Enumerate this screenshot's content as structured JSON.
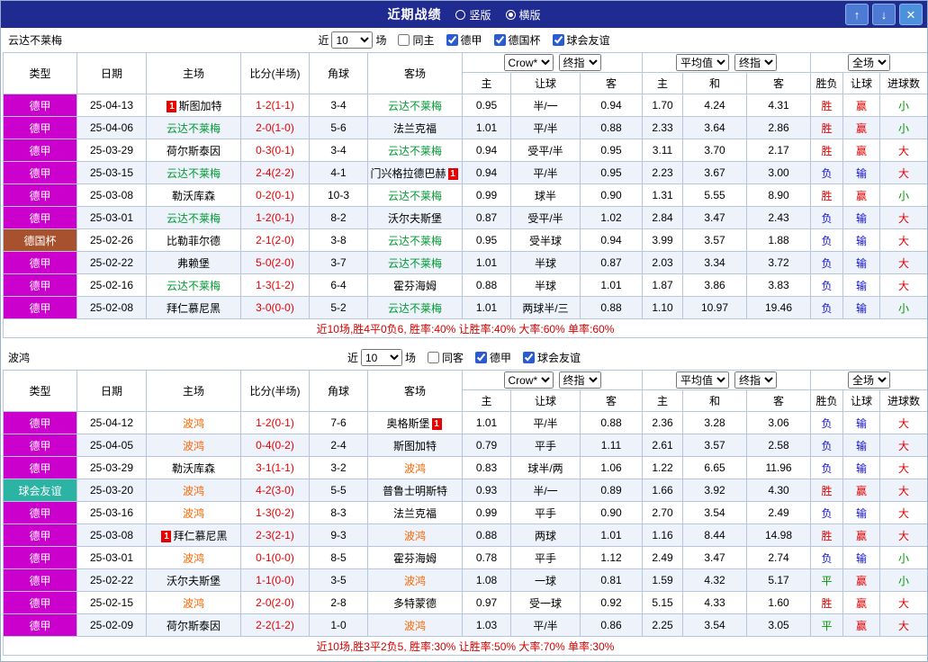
{
  "header": {
    "title": "近期战绩",
    "view_options": [
      {
        "label": "竖版",
        "selected": false
      },
      {
        "label": "横版",
        "selected": true
      }
    ],
    "buttons": {
      "up": "↑",
      "down": "↓",
      "close": "✕"
    }
  },
  "colors": {
    "titlebar_bg": "#1f2b90",
    "button_bg": "#4d7ad2",
    "close_button_bg": "#4d90dc",
    "border": "#b7c5dd",
    "stripe": "#eef3fb",
    "score": "#e60000",
    "summary": "#d40000",
    "type_colors": {
      "德甲": "#cc00cc",
      "德国杯": "#a8512e",
      "球会友谊": "#2bb3a3"
    },
    "result": {
      "red": "#e60000",
      "blue": "#1313cf",
      "green": "#009900"
    }
  },
  "sections": [
    {
      "team": "云达不莱梅",
      "team_color": "#009933",
      "filter": {
        "prefix": "近",
        "count": "10",
        "suffix": "场",
        "checkboxes": [
          {
            "label": "同主",
            "checked": false
          },
          {
            "label": "德甲",
            "checked": true
          },
          {
            "label": "德国杯",
            "checked": true
          },
          {
            "label": "球会友谊",
            "checked": true
          }
        ]
      },
      "selects": {
        "company": "Crow*",
        "company_stage": "终指",
        "euro": "平均值",
        "euro_stage": "终指",
        "scope": "全场"
      },
      "columns": [
        "类型",
        "日期",
        "主场",
        "比分(半场)",
        "角球",
        "客场",
        "主",
        "让球",
        "客",
        "主",
        "和",
        "客",
        "胜负",
        "让球",
        "进球数"
      ],
      "rows": [
        {
          "tp": "德甲",
          "dt": "25-04-13",
          "hm": "斯图加特",
          "hmT": false,
          "hmC": "before",
          "sc": "1-2(1-1)",
          "cn": "3-4",
          "aw": "云达不莱梅",
          "awT": true,
          "awC": "",
          "od": [
            "0.95",
            "半/一",
            "0.94"
          ],
          "eu": [
            "1.70",
            "4.24",
            "4.31"
          ],
          "rs": [
            [
              "胜",
              "red"
            ],
            [
              "赢",
              "red"
            ],
            [
              "小",
              "green"
            ]
          ]
        },
        {
          "tp": "德甲",
          "dt": "25-04-06",
          "hm": "云达不莱梅",
          "hmT": true,
          "hmC": "",
          "sc": "2-0(1-0)",
          "cn": "5-6",
          "aw": "法兰克福",
          "awT": false,
          "awC": "",
          "od": [
            "1.01",
            "平/半",
            "0.88"
          ],
          "eu": [
            "2.33",
            "3.64",
            "2.86"
          ],
          "rs": [
            [
              "胜",
              "red"
            ],
            [
              "赢",
              "red"
            ],
            [
              "小",
              "green"
            ]
          ]
        },
        {
          "tp": "德甲",
          "dt": "25-03-29",
          "hm": "荷尔斯泰因",
          "hmT": false,
          "hmC": "",
          "sc": "0-3(0-1)",
          "cn": "3-4",
          "aw": "云达不莱梅",
          "awT": true,
          "awC": "",
          "od": [
            "0.94",
            "受平/半",
            "0.95"
          ],
          "eu": [
            "3.11",
            "3.70",
            "2.17"
          ],
          "rs": [
            [
              "胜",
              "red"
            ],
            [
              "赢",
              "red"
            ],
            [
              "大",
              "red"
            ]
          ]
        },
        {
          "tp": "德甲",
          "dt": "25-03-15",
          "hm": "云达不莱梅",
          "hmT": true,
          "hmC": "",
          "sc": "2-4(2-2)",
          "cn": "4-1",
          "aw": "门兴格拉德巴赫",
          "awT": false,
          "awC": "after",
          "od": [
            "0.94",
            "平/半",
            "0.95"
          ],
          "eu": [
            "2.23",
            "3.67",
            "3.00"
          ],
          "rs": [
            [
              "负",
              "blue"
            ],
            [
              "输",
              "blue"
            ],
            [
              "大",
              "red"
            ]
          ]
        },
        {
          "tp": "德甲",
          "dt": "25-03-08",
          "hm": "勒沃库森",
          "hmT": false,
          "hmC": "",
          "sc": "0-2(0-1)",
          "cn": "10-3",
          "aw": "云达不莱梅",
          "awT": true,
          "awC": "",
          "od": [
            "0.99",
            "球半",
            "0.90"
          ],
          "eu": [
            "1.31",
            "5.55",
            "8.90"
          ],
          "rs": [
            [
              "胜",
              "red"
            ],
            [
              "赢",
              "red"
            ],
            [
              "小",
              "green"
            ]
          ]
        },
        {
          "tp": "德甲",
          "dt": "25-03-01",
          "hm": "云达不莱梅",
          "hmT": true,
          "hmC": "",
          "sc": "1-2(0-1)",
          "cn": "8-2",
          "aw": "沃尔夫斯堡",
          "awT": false,
          "awC": "",
          "od": [
            "0.87",
            "受平/半",
            "1.02"
          ],
          "eu": [
            "2.84",
            "3.47",
            "2.43"
          ],
          "rs": [
            [
              "负",
              "blue"
            ],
            [
              "输",
              "blue"
            ],
            [
              "大",
              "red"
            ]
          ]
        },
        {
          "tp": "德国杯",
          "dt": "25-02-26",
          "hm": "比勒菲尔德",
          "hmT": false,
          "hmC": "",
          "sc": "2-1(2-0)",
          "cn": "3-8",
          "aw": "云达不莱梅",
          "awT": true,
          "awC": "",
          "od": [
            "0.95",
            "受半球",
            "0.94"
          ],
          "eu": [
            "3.99",
            "3.57",
            "1.88"
          ],
          "rs": [
            [
              "负",
              "blue"
            ],
            [
              "输",
              "blue"
            ],
            [
              "大",
              "red"
            ]
          ]
        },
        {
          "tp": "德甲",
          "dt": "25-02-22",
          "hm": "弗赖堡",
          "hmT": false,
          "hmC": "",
          "sc": "5-0(2-0)",
          "cn": "3-7",
          "aw": "云达不莱梅",
          "awT": true,
          "awC": "",
          "od": [
            "1.01",
            "半球",
            "0.87"
          ],
          "eu": [
            "2.03",
            "3.34",
            "3.72"
          ],
          "rs": [
            [
              "负",
              "blue"
            ],
            [
              "输",
              "blue"
            ],
            [
              "大",
              "red"
            ]
          ]
        },
        {
          "tp": "德甲",
          "dt": "25-02-16",
          "hm": "云达不莱梅",
          "hmT": true,
          "hmC": "",
          "sc": "1-3(1-2)",
          "cn": "6-4",
          "aw": "霍芬海姆",
          "awT": false,
          "awC": "",
          "od": [
            "0.88",
            "半球",
            "1.01"
          ],
          "eu": [
            "1.87",
            "3.86",
            "3.83"
          ],
          "rs": [
            [
              "负",
              "blue"
            ],
            [
              "输",
              "blue"
            ],
            [
              "大",
              "red"
            ]
          ]
        },
        {
          "tp": "德甲",
          "dt": "25-02-08",
          "hm": "拜仁慕尼黑",
          "hmT": false,
          "hmC": "",
          "sc": "3-0(0-0)",
          "cn": "5-2",
          "aw": "云达不莱梅",
          "awT": true,
          "awC": "",
          "od": [
            "1.01",
            "两球半/三",
            "0.88"
          ],
          "eu": [
            "1.10",
            "10.97",
            "19.46"
          ],
          "rs": [
            [
              "负",
              "blue"
            ],
            [
              "输",
              "blue"
            ],
            [
              "小",
              "green"
            ]
          ]
        }
      ],
      "summary": "近10场,胜4平0负6, 胜率:40% 让胜率:40% 大率:60% 单率:60%"
    },
    {
      "team": "波鸿",
      "team_color": "#ff6600",
      "filter": {
        "prefix": "近",
        "count": "10",
        "suffix": "场",
        "checkboxes": [
          {
            "label": "同客",
            "checked": false
          },
          {
            "label": "德甲",
            "checked": true
          },
          {
            "label": "球会友谊",
            "checked": true
          }
        ]
      },
      "selects": {
        "company": "Crow*",
        "company_stage": "终指",
        "euro": "平均值",
        "euro_stage": "终指",
        "scope": "全场"
      },
      "columns": [
        "类型",
        "日期",
        "主场",
        "比分(半场)",
        "角球",
        "客场",
        "主",
        "让球",
        "客",
        "主",
        "和",
        "客",
        "胜负",
        "让球",
        "进球数"
      ],
      "rows": [
        {
          "tp": "德甲",
          "dt": "25-04-12",
          "hm": "波鸿",
          "hmT": true,
          "hmC": "",
          "sc": "1-2(0-1)",
          "cn": "7-6",
          "aw": "奥格斯堡",
          "awT": false,
          "awC": "after",
          "od": [
            "1.01",
            "平/半",
            "0.88"
          ],
          "eu": [
            "2.36",
            "3.28",
            "3.06"
          ],
          "rs": [
            [
              "负",
              "blue"
            ],
            [
              "输",
              "blue"
            ],
            [
              "大",
              "red"
            ]
          ]
        },
        {
          "tp": "德甲",
          "dt": "25-04-05",
          "hm": "波鸿",
          "hmT": true,
          "hmC": "",
          "sc": "0-4(0-2)",
          "cn": "2-4",
          "aw": "斯图加特",
          "awT": false,
          "awC": "",
          "od": [
            "0.79",
            "平手",
            "1.11"
          ],
          "eu": [
            "2.61",
            "3.57",
            "2.58"
          ],
          "rs": [
            [
              "负",
              "blue"
            ],
            [
              "输",
              "blue"
            ],
            [
              "大",
              "red"
            ]
          ]
        },
        {
          "tp": "德甲",
          "dt": "25-03-29",
          "hm": "勒沃库森",
          "hmT": false,
          "hmC": "",
          "sc": "3-1(1-1)",
          "cn": "3-2",
          "aw": "波鸿",
          "awT": true,
          "awC": "",
          "od": [
            "0.83",
            "球半/两",
            "1.06"
          ],
          "eu": [
            "1.22",
            "6.65",
            "11.96"
          ],
          "rs": [
            [
              "负",
              "blue"
            ],
            [
              "输",
              "blue"
            ],
            [
              "大",
              "red"
            ]
          ]
        },
        {
          "tp": "球会友谊",
          "dt": "25-03-20",
          "hm": "波鸿",
          "hmT": true,
          "hmC": "",
          "sc": "4-2(3-0)",
          "cn": "5-5",
          "aw": "普鲁士明斯特",
          "awT": false,
          "awC": "",
          "od": [
            "0.93",
            "半/一",
            "0.89"
          ],
          "eu": [
            "1.66",
            "3.92",
            "4.30"
          ],
          "rs": [
            [
              "胜",
              "red"
            ],
            [
              "赢",
              "red"
            ],
            [
              "大",
              "red"
            ]
          ]
        },
        {
          "tp": "德甲",
          "dt": "25-03-16",
          "hm": "波鸿",
          "hmT": true,
          "hmC": "",
          "sc": "1-3(0-2)",
          "cn": "8-3",
          "aw": "法兰克福",
          "awT": false,
          "awC": "",
          "od": [
            "0.99",
            "平手",
            "0.90"
          ],
          "eu": [
            "2.70",
            "3.54",
            "2.49"
          ],
          "rs": [
            [
              "负",
              "blue"
            ],
            [
              "输",
              "blue"
            ],
            [
              "大",
              "red"
            ]
          ]
        },
        {
          "tp": "德甲",
          "dt": "25-03-08",
          "hm": "拜仁慕尼黑",
          "hmT": false,
          "hmC": "before",
          "sc": "2-3(2-1)",
          "cn": "9-3",
          "aw": "波鸿",
          "awT": true,
          "awC": "",
          "od": [
            "0.88",
            "两球",
            "1.01"
          ],
          "eu": [
            "1.16",
            "8.44",
            "14.98"
          ],
          "rs": [
            [
              "胜",
              "red"
            ],
            [
              "赢",
              "red"
            ],
            [
              "大",
              "red"
            ]
          ]
        },
        {
          "tp": "德甲",
          "dt": "25-03-01",
          "hm": "波鸿",
          "hmT": true,
          "hmC": "",
          "sc": "0-1(0-0)",
          "cn": "8-5",
          "aw": "霍芬海姆",
          "awT": false,
          "awC": "",
          "od": [
            "0.78",
            "平手",
            "1.12"
          ],
          "eu": [
            "2.49",
            "3.47",
            "2.74"
          ],
          "rs": [
            [
              "负",
              "blue"
            ],
            [
              "输",
              "blue"
            ],
            [
              "小",
              "green"
            ]
          ]
        },
        {
          "tp": "德甲",
          "dt": "25-02-22",
          "hm": "沃尔夫斯堡",
          "hmT": false,
          "hmC": "",
          "sc": "1-1(0-0)",
          "cn": "3-5",
          "aw": "波鸿",
          "awT": true,
          "awC": "",
          "od": [
            "1.08",
            "一球",
            "0.81"
          ],
          "eu": [
            "1.59",
            "4.32",
            "5.17"
          ],
          "rs": [
            [
              "平",
              "green"
            ],
            [
              "赢",
              "red"
            ],
            [
              "小",
              "green"
            ]
          ]
        },
        {
          "tp": "德甲",
          "dt": "25-02-15",
          "hm": "波鸿",
          "hmT": true,
          "hmC": "",
          "sc": "2-0(2-0)",
          "cn": "2-8",
          "aw": "多特蒙德",
          "awT": false,
          "awC": "",
          "od": [
            "0.97",
            "受一球",
            "0.92"
          ],
          "eu": [
            "5.15",
            "4.33",
            "1.60"
          ],
          "rs": [
            [
              "胜",
              "red"
            ],
            [
              "赢",
              "red"
            ],
            [
              "大",
              "red"
            ]
          ]
        },
        {
          "tp": "德甲",
          "dt": "25-02-09",
          "hm": "荷尔斯泰因",
          "hmT": false,
          "hmC": "",
          "sc": "2-2(1-2)",
          "cn": "1-0",
          "aw": "波鸿",
          "awT": true,
          "awC": "",
          "od": [
            "1.03",
            "平/半",
            "0.86"
          ],
          "eu": [
            "2.25",
            "3.54",
            "3.05"
          ],
          "rs": [
            [
              "平",
              "green"
            ],
            [
              "赢",
              "red"
            ],
            [
              "大",
              "red"
            ]
          ]
        }
      ],
      "summary": "近10场,胜3平2负5, 胜率:30% 让胜率:50% 大率:70% 单率:30%"
    }
  ]
}
